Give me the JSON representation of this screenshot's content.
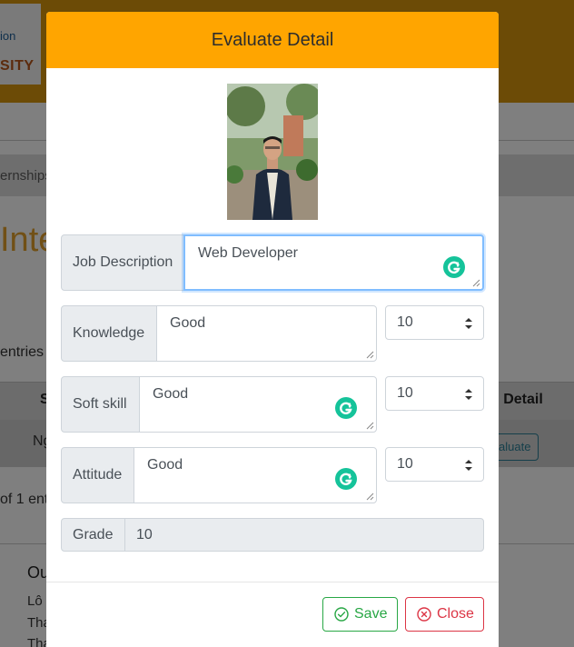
{
  "background": {
    "logo_line1": "ion",
    "logo_line2": "SITY",
    "breadcrumb": "ernships",
    "page_title": "Inte",
    "entries_label": "entries",
    "table_header_left": "S",
    "table_header_right": "n Detail",
    "row_text": "Ng",
    "row_button": "aluate",
    "info_text": "of 1 entr",
    "footer_heading": "Ou",
    "footer_line1": "Lô",
    "footer_line2": "Tha",
    "footer_line3": "Tha"
  },
  "modal": {
    "title": "Evaluate Detail",
    "fields": {
      "job_description": {
        "label": "Job Description",
        "value": "Web Developer"
      },
      "knowledge": {
        "label": "Knowledge",
        "value": "Good",
        "score": "10"
      },
      "soft_skill": {
        "label": "Soft skill",
        "value": "Good",
        "score": "10"
      },
      "attitude": {
        "label": "Attitude",
        "value": "Good",
        "score": "10"
      },
      "grade": {
        "label": "Grade",
        "value": "10"
      }
    },
    "buttons": {
      "save": "Save",
      "close": "Close"
    }
  },
  "colors": {
    "header_accent": "#ffa500",
    "save_green": "#28a745",
    "close_red": "#dc3545",
    "grammarly_green": "#15c39a",
    "focus_blue": "#80bdff"
  }
}
